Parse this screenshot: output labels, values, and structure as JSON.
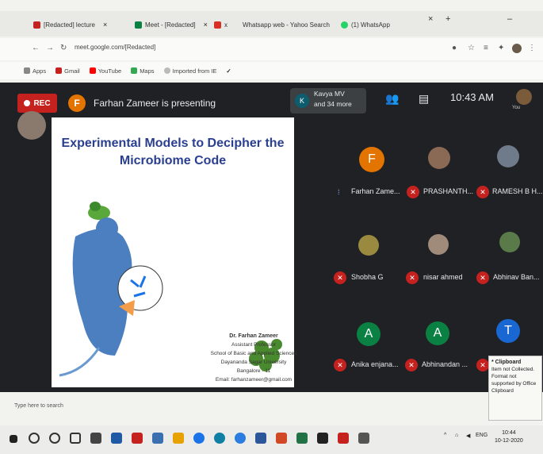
{
  "browser": {
    "tabs": [
      {
        "label": "[Redacted] lecture"
      },
      {
        "label": "Meet - [Redacted]"
      },
      {
        "label": "x"
      },
      {
        "label": "Whatsapp web - Yahoo Search"
      },
      {
        "label": "(1) WhatsApp"
      }
    ],
    "new_tab": "+",
    "window_controls": [
      "–",
      "□",
      "×"
    ],
    "address": "meet.google.com/[Redacted]",
    "bookmarks": [
      "Apps",
      "Gmail",
      "YouTube",
      "Maps",
      "Imported from IE"
    ],
    "colors": {
      "gmail": "#c5221f",
      "youtube": "#ff0000",
      "maps": "#34a853"
    }
  },
  "meet": {
    "rec_label": "REC",
    "presenter_initial": "F",
    "presenting_text": "Farhan Zameer is presenting",
    "participants_initial": "K",
    "participants_line1": "Kavya MV",
    "participants_line2": "and 34 more",
    "time": "10:43 AM",
    "self_label": "You"
  },
  "slide": {
    "title_line1": "Experimental Models to Decipher the",
    "title_line2": "Microbiome Code",
    "speaker_name": "Dr. Farhan Zameer",
    "speaker_role": "Assistant Professor",
    "speaker_school": "School of Basic and Applied Sciences",
    "speaker_university": "Dayananda Sagar University",
    "speaker_city": "Bangalore - 11",
    "speaker_email": "Email: farhanzameer@gmail.com"
  },
  "participants": [
    {
      "name": "Farhan Zame...",
      "initial": "F",
      "color": "#e37400"
    },
    {
      "name": "PRASHANTH...",
      "initial": "",
      "color": "#8a6a55"
    },
    {
      "name": "RAMESH B H...",
      "initial": "",
      "color": "#6f7b8a"
    },
    {
      "name": "Shobha G",
      "initial": "",
      "color": "#9a8a40"
    },
    {
      "name": "nisar ahmed",
      "initial": "",
      "color": "#a08a7a"
    },
    {
      "name": "Abhinav Ban...",
      "initial": "",
      "color": "#5a7a4a"
    },
    {
      "name": "Anika enjana...",
      "initial": "A",
      "color": "#0b8043"
    },
    {
      "name": "Abhinandan ...",
      "initial": "A",
      "color": "#0b8043"
    },
    {
      "name": "",
      "initial": "T",
      "color": "#1967d2"
    }
  ],
  "clipboard": {
    "title": "* Clipboard",
    "body": "Item not Collected. Format not supported by Office Clipboard"
  },
  "below_text": "Type here to search",
  "taskbar": {
    "lang": "ENG",
    "time": "10:44",
    "date": "10-12-2020"
  }
}
